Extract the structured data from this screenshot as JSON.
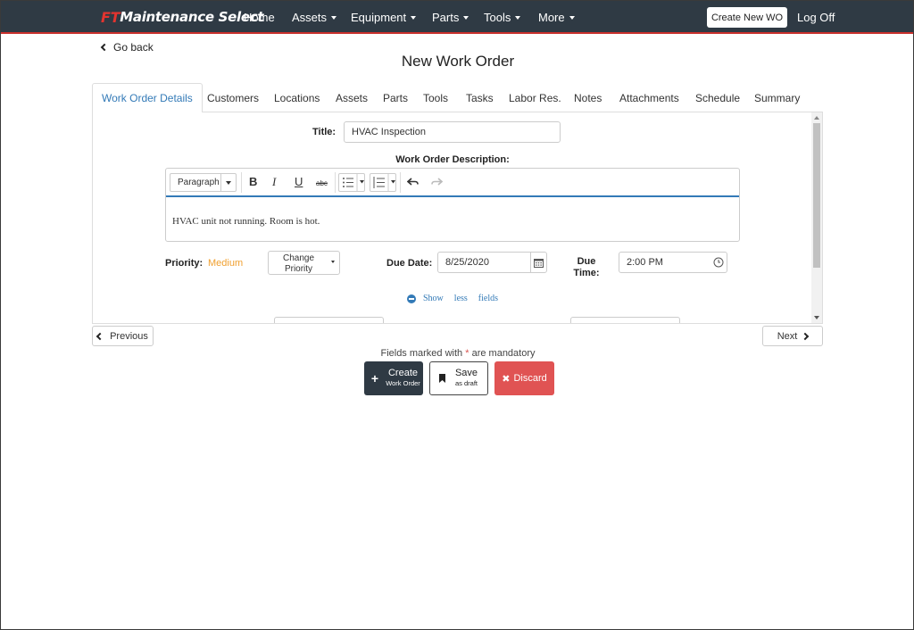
{
  "navbar": {
    "brand_prefix": "FT",
    "brand_name": "Maintenance Select",
    "items": [
      {
        "label": "Home",
        "dropdown": false
      },
      {
        "label": "Assets",
        "dropdown": true
      },
      {
        "label": "Equipment",
        "dropdown": true
      },
      {
        "label": "Parts",
        "dropdown": true
      },
      {
        "label": "Tools",
        "dropdown": true
      },
      {
        "label": "More",
        "dropdown": true
      }
    ],
    "create_button": "Create New WO",
    "logoff": "Log Off"
  },
  "header": {
    "go_back": "Go back",
    "title": "New Work Order"
  },
  "tabs": [
    {
      "label": "Work Order Details",
      "active": true
    },
    {
      "label": "Customers"
    },
    {
      "label": "Locations"
    },
    {
      "label": "Assets"
    },
    {
      "label": "Parts"
    },
    {
      "label": "Tools"
    },
    {
      "label": "Tasks"
    },
    {
      "label": "Labor Res."
    },
    {
      "label": "Notes"
    },
    {
      "label": "Attachments"
    },
    {
      "label": "Schedule"
    },
    {
      "label": "Summary"
    }
  ],
  "form": {
    "title_label": "Title:",
    "title_value": "HVAC Inspection",
    "description_label": "Work Order Description:",
    "editor": {
      "paragraph_select": "Paragraph",
      "bold": "B",
      "italic": "I",
      "underline": "U",
      "strike": "abc",
      "body": "HVAC unit not running. Room is hot."
    },
    "priority_label": "Priority:",
    "priority_value": "Medium",
    "change_priority": "Change Priority",
    "due_date_label": "Due Date:",
    "due_date_value": "8/25/2020",
    "due_time_label": "Due Time:",
    "due_time_value": "2:00 PM",
    "show_less": [
      "Show",
      "less",
      "fields"
    ]
  },
  "footer": {
    "previous": "Previous",
    "next": "Next",
    "mandatory_prefix": "Fields marked with",
    "mandatory_star": "*",
    "mandatory_suffix": "are mandatory",
    "create_main": "Create",
    "create_sub": "Work Order",
    "save_main": "Save",
    "save_sub": "as draft",
    "discard": "Discard"
  },
  "colors": {
    "navbar": "#2f3a44",
    "accent": "#337ab7",
    "danger": "#e05353",
    "priority_medium": "#f0a030"
  }
}
